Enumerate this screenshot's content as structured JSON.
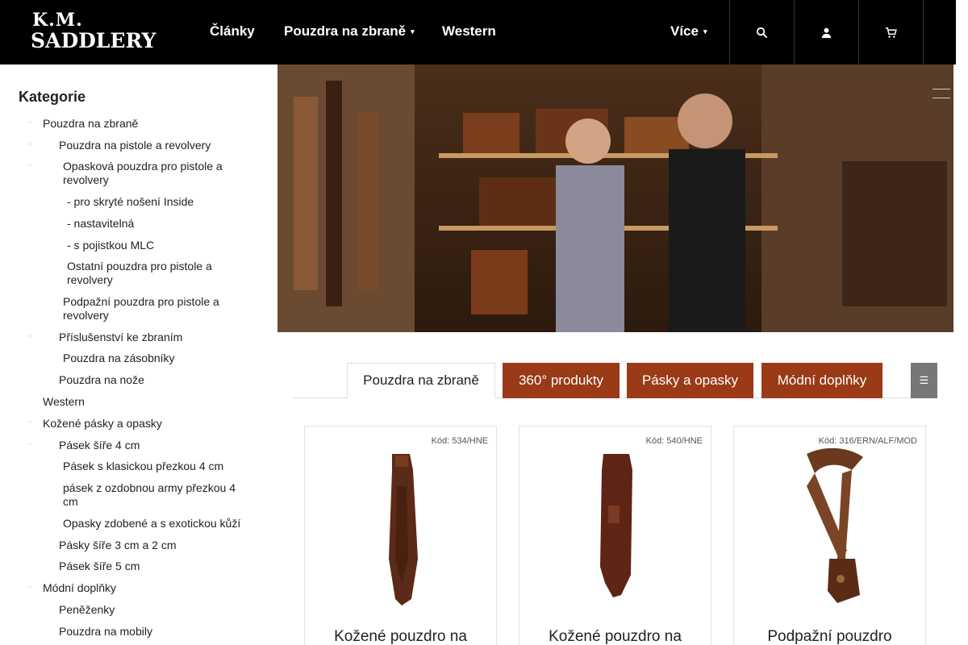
{
  "brand": {
    "line1": "K.M.",
    "line2": "SADDLERY"
  },
  "nav": {
    "articles": "Články",
    "holsters": "Pouzdra na zbraně",
    "western": "Western",
    "more": "Více"
  },
  "sidebar": {
    "title": "Kategorie",
    "items": [
      "Pouzdra na zbraně",
      "Pouzdra na pistole a revolvery",
      "Opasková pouzdra pro pistole a revolvery",
      "- pro skryté nošení Inside",
      "- nastavitelná",
      "- s pojistkou MLC",
      "Ostatní pouzdra pro pistole a revolvery",
      "Podpažní pouzdra pro pistole a revolvery",
      "Příslušenství ke zbraním",
      "Pouzdra na zásobníky",
      "Pouzdra na nože",
      "Western",
      "Kožené pásky a opasky",
      "Pásek šíře 4 cm",
      "Pásek s klasickou přezkou 4 cm",
      "pásek z ozdobnou army přezkou 4 cm",
      "Opasky zdobené a s exotickou kůží",
      "Pásky šíře 3 cm a 2 cm",
      "Pásek šíře 5 cm",
      "Módní doplňky",
      "Peněženky",
      "Pouzdra na mobily"
    ]
  },
  "tabs": [
    "Pouzdra na zbraně",
    "360° produkty",
    "Pásky a opasky",
    "Módní doplňky"
  ],
  "tab_toggle": "☰",
  "products": [
    {
      "code": "Kód: 534/HNE",
      "title": "Kožené pouzdro na"
    },
    {
      "code": "Kód: 540/HNE",
      "title": "Kožené pouzdro na"
    },
    {
      "code": "Kód: 316/ERN/ALF/MOD",
      "title": "Podpažní pouzdro"
    }
  ],
  "colors": {
    "header": "#000000",
    "accent": "#9a3a16",
    "toggle": "#777777"
  },
  "icons": {
    "header": [
      "search-icon",
      "user-icon",
      "cart-icon"
    ]
  }
}
